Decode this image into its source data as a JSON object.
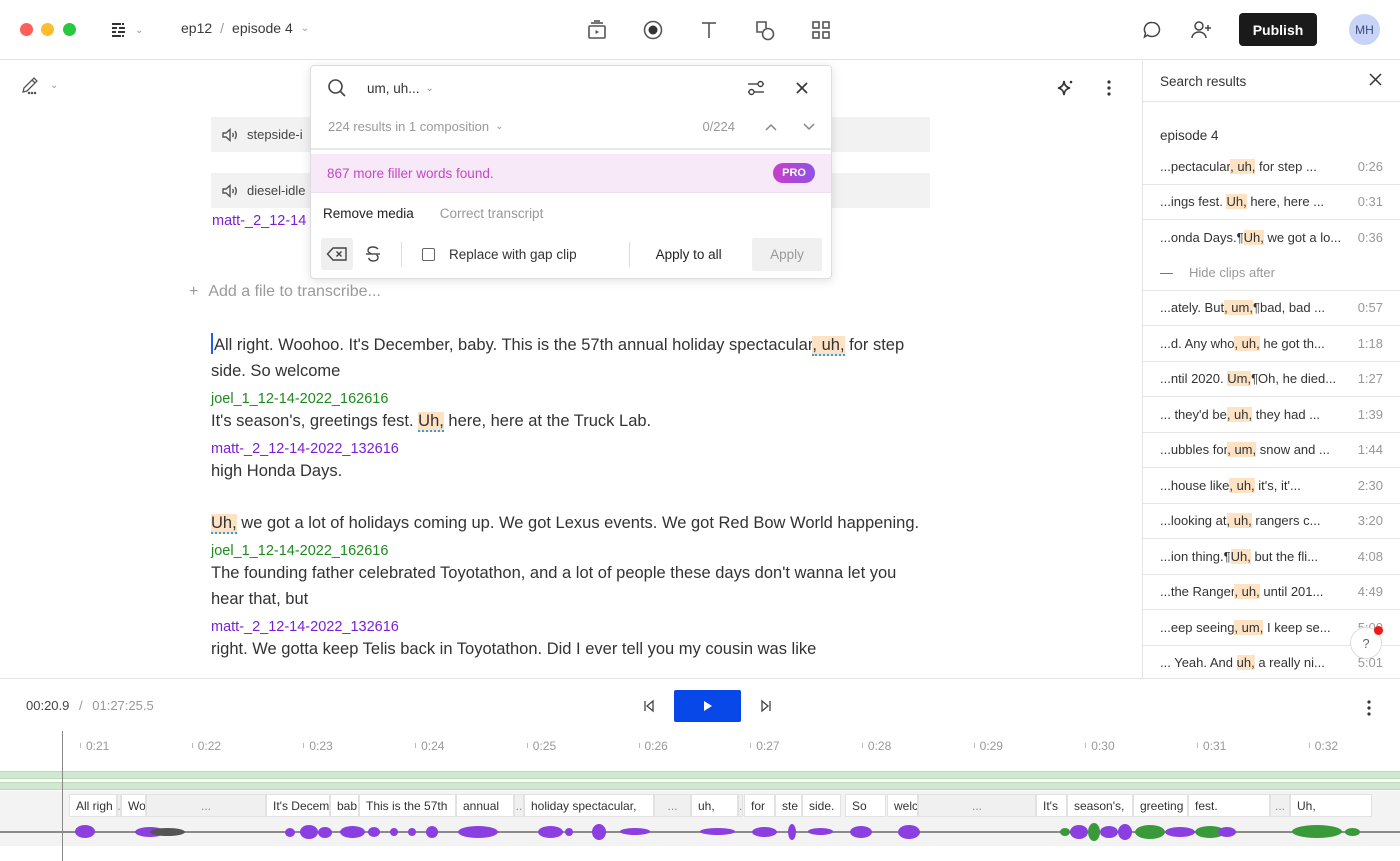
{
  "window": {
    "breadcrumb": {
      "project": "ep12",
      "separator": "/",
      "composition": "episode 4"
    }
  },
  "toolbar": {
    "tools": [
      "media-icon",
      "record-icon",
      "text-icon",
      "shapes-icon",
      "grid-icon"
    ],
    "publish_label": "Publish",
    "avatar_initials": "MH"
  },
  "editor": {
    "media_clips": [
      {
        "label": "stepside-i",
        "icon": "speaker-icon"
      },
      {
        "label": "diesel-idle",
        "icon": "speaker-icon"
      }
    ],
    "partial_speaker": "matt-_2_12-14",
    "add_file_label": "Add a file to transcribe...",
    "transcript": {
      "p1_before": "All right. Woohoo. It's December, baby. This is the 57th annual holiday spectacular",
      "p1_hl": ", uh,",
      "p1_after": " for step side. So welcome",
      "s2": "joel_1_12-14-2022_162616",
      "p2_before": "It's season's, greetings fest. ",
      "p2_hl": "Uh,",
      "p2_after": " here, here at the Truck Lab.",
      "s3": "matt-_2_12-14-2022_132616",
      "p3": "high Honda Days.",
      "p4_hl": "Uh,",
      "p4_after": " we got a lot of holidays coming up. We got Lexus events. We got Red Bow World happening.",
      "s5": "joel_1_12-14-2022_162616",
      "p5": "The founding father celebrated Toyotathon, and a lot of people these days don't wanna let you hear that, but",
      "s6": "matt-_2_12-14-2022_132616",
      "p6_partial": "right. We gotta keep Telis back in Toyotathon. Did I ever tell you my cousin was like"
    }
  },
  "search": {
    "query": "um, uh...",
    "results_summary": "224 results in 1 composition",
    "counter": "0/224",
    "pro_message": "867 more filler words found.",
    "pro_badge": "PRO",
    "tabs": [
      "Remove media",
      "Correct transcript"
    ],
    "active_tab": "Remove media",
    "replace_gap_label": "Replace with gap clip",
    "replace_gap_checked": false,
    "apply_all_label": "Apply to all",
    "apply_label": "Apply"
  },
  "results_panel": {
    "title": "Search results",
    "group": "episode 4",
    "hide_clips_label": "Hide clips after",
    "items": [
      {
        "pre": "...pectacular",
        "hl": ", uh,",
        "post": " for step ...",
        "time": "0:26"
      },
      {
        "pre": "...ings fest. ",
        "hl": "Uh,",
        "post": " here, here ...",
        "time": "0:31"
      },
      {
        "pre": "...onda Days.¶",
        "hl": "Uh,",
        "post": " we got a lo...",
        "time": "0:36"
      },
      {
        "pre": "...ately. But",
        "hl": ", um,",
        "post": "¶bad, bad ...",
        "time": "0:57"
      },
      {
        "pre": "...d. Any who",
        "hl": ", uh,",
        "post": " he got th...",
        "time": "1:18"
      },
      {
        "pre": "...ntil 2020. ",
        "hl": "Um,",
        "post": "¶Oh, he died...",
        "time": "1:27"
      },
      {
        "pre": "... they'd be",
        "hl": ", uh,",
        "post": " they had ...",
        "time": "1:39"
      },
      {
        "pre": "...ubbles for",
        "hl": ", um,",
        "post": " snow and ...",
        "time": "1:44"
      },
      {
        "pre": "...house like",
        "hl": ", uh,",
        "post": " it's, it'...",
        "time": "2:30"
      },
      {
        "pre": "...looking at",
        "hl": ", uh,",
        "post": " rangers c...",
        "time": "3:20"
      },
      {
        "pre": "...ion thing.¶",
        "hl": "Uh,",
        "post": " but the fli...",
        "time": "4:08"
      },
      {
        "pre": "...the Ranger",
        "hl": ", uh,",
        "post": " until 201...",
        "time": "4:49"
      },
      {
        "pre": "...eep seeing",
        "hl": ", um,",
        "post": " I keep se...",
        "time": "5:00"
      },
      {
        "pre": "... Yeah. And ",
        "hl": "uh,",
        "post": " a really ni...",
        "time": "5:01"
      }
    ]
  },
  "help": {
    "label": "?"
  },
  "player": {
    "current_time": "00:20.9",
    "separator": "/",
    "total_time": "01:27:25.5",
    "ruler_ticks": [
      "0:21",
      "0:22",
      "0:23",
      "0:24",
      "0:25",
      "0:26",
      "0:27",
      "0:28",
      "0:29",
      "0:30",
      "0:31",
      "0:32"
    ],
    "words": [
      "All righ",
      ".",
      "Wo",
      "...",
      "It's Decem",
      "bab",
      "This is the 57th",
      "annual",
      "..",
      "holiday spectacular,",
      "...",
      "uh,",
      ".",
      "for",
      "ste",
      "side.",
      "So",
      "welc",
      "...",
      "It's",
      "season's,",
      "greeting",
      "fest.",
      "...",
      "Uh,"
    ]
  },
  "colors": {
    "accent_blue": "#0848e8",
    "speaker_purple": "#7b1fd6",
    "speaker_green": "#1f8a1f",
    "filler_highlight": "#fde2c4",
    "pro_pink": "#c746c7"
  }
}
